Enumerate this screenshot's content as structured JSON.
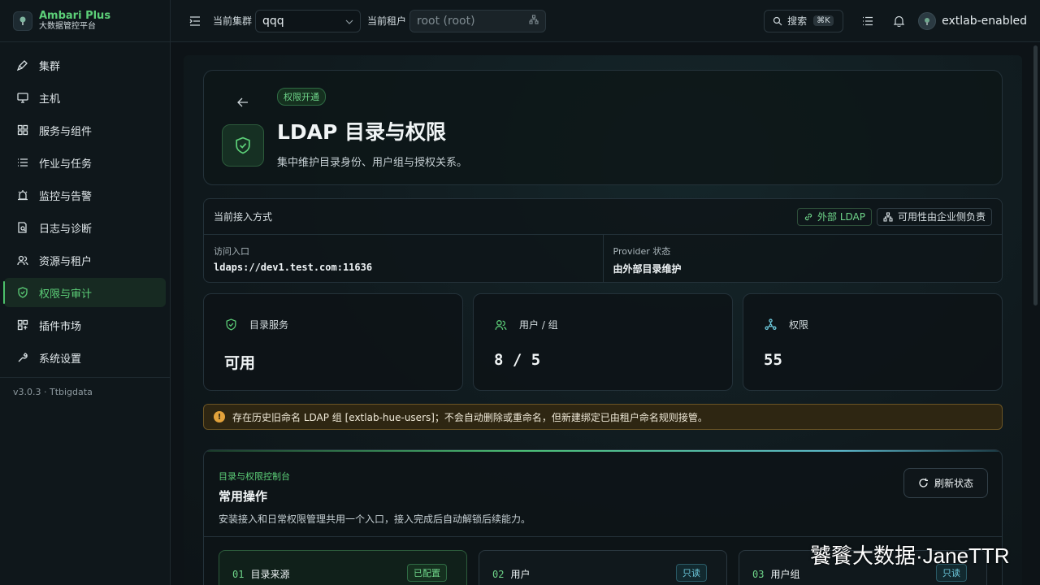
{
  "brand": {
    "title": "Ambari Plus",
    "subtitle": "大数据管控平台"
  },
  "sidebar": {
    "items": [
      {
        "label": "集群",
        "icon": "rocket-icon"
      },
      {
        "label": "主机",
        "icon": "monitor-icon"
      },
      {
        "label": "服务与组件",
        "icon": "grid-icon"
      },
      {
        "label": "作业与任务",
        "icon": "list-icon"
      },
      {
        "label": "监控与告警",
        "icon": "alarm-icon"
      },
      {
        "label": "日志与诊断",
        "icon": "file-search-icon"
      },
      {
        "label": "资源与租户",
        "icon": "users-icon"
      },
      {
        "label": "权限与审计",
        "icon": "shield-check-icon",
        "active": true
      },
      {
        "label": "插件市场",
        "icon": "puzzle-icon"
      },
      {
        "label": "系统设置",
        "icon": "wrench-icon"
      }
    ],
    "version": "v3.0.3 · Ttbigdata"
  },
  "topbar": {
    "cluster_label": "当前集群",
    "cluster_value": "qqq",
    "tenant_label": "当前租户",
    "tenant_value": "root (root)",
    "search_label": "搜索",
    "search_shortcut": "⌘K",
    "username": "extlab-enabled"
  },
  "hero": {
    "badge": "权限开通",
    "title": "LDAP 目录与权限",
    "description": "集中维护目录身份、用户组与授权关系。"
  },
  "access": {
    "header": "当前接入方式",
    "chip_external": "外部 LDAP",
    "chip_availability": "可用性由企业侧负责",
    "entry_label": "访问入口",
    "entry_value": "ldaps://dev1.test.com:11636",
    "provider_label": "Provider 状态",
    "provider_value": "由外部目录维护"
  },
  "stats": [
    {
      "label": "目录服务",
      "value": "可用",
      "icon": "shield-check-icon"
    },
    {
      "label": "用户 / 组",
      "value": "8 / 5",
      "icon": "users-icon"
    },
    {
      "label": "权限",
      "value": "55",
      "icon": "network-icon"
    }
  ],
  "warning": "存在历史旧命名 LDAP 组 [extlab-hue-users]；不会自动删除或重命名，但新建绑定已由租户命名规则接管。",
  "console": {
    "eyebrow": "目录与权限控制台",
    "title": "常用操作",
    "description": "安装接入和日常权限管理共用一个入口，接入完成后自动解锁后续能力。",
    "refresh_label": "刷新状态",
    "steps": [
      {
        "num": "01",
        "name": "目录来源",
        "badge": "已配置"
      },
      {
        "num": "02",
        "name": "用户",
        "badge": "只读"
      },
      {
        "num": "03",
        "name": "用户组",
        "badge": "只读"
      }
    ]
  },
  "watermark": "饕餮大数据·JaneTTR",
  "colors": {
    "accent": "#5ccf78",
    "warning": "#e2a23b",
    "cyan": "#6cc7da",
    "background": "#0d1317"
  }
}
